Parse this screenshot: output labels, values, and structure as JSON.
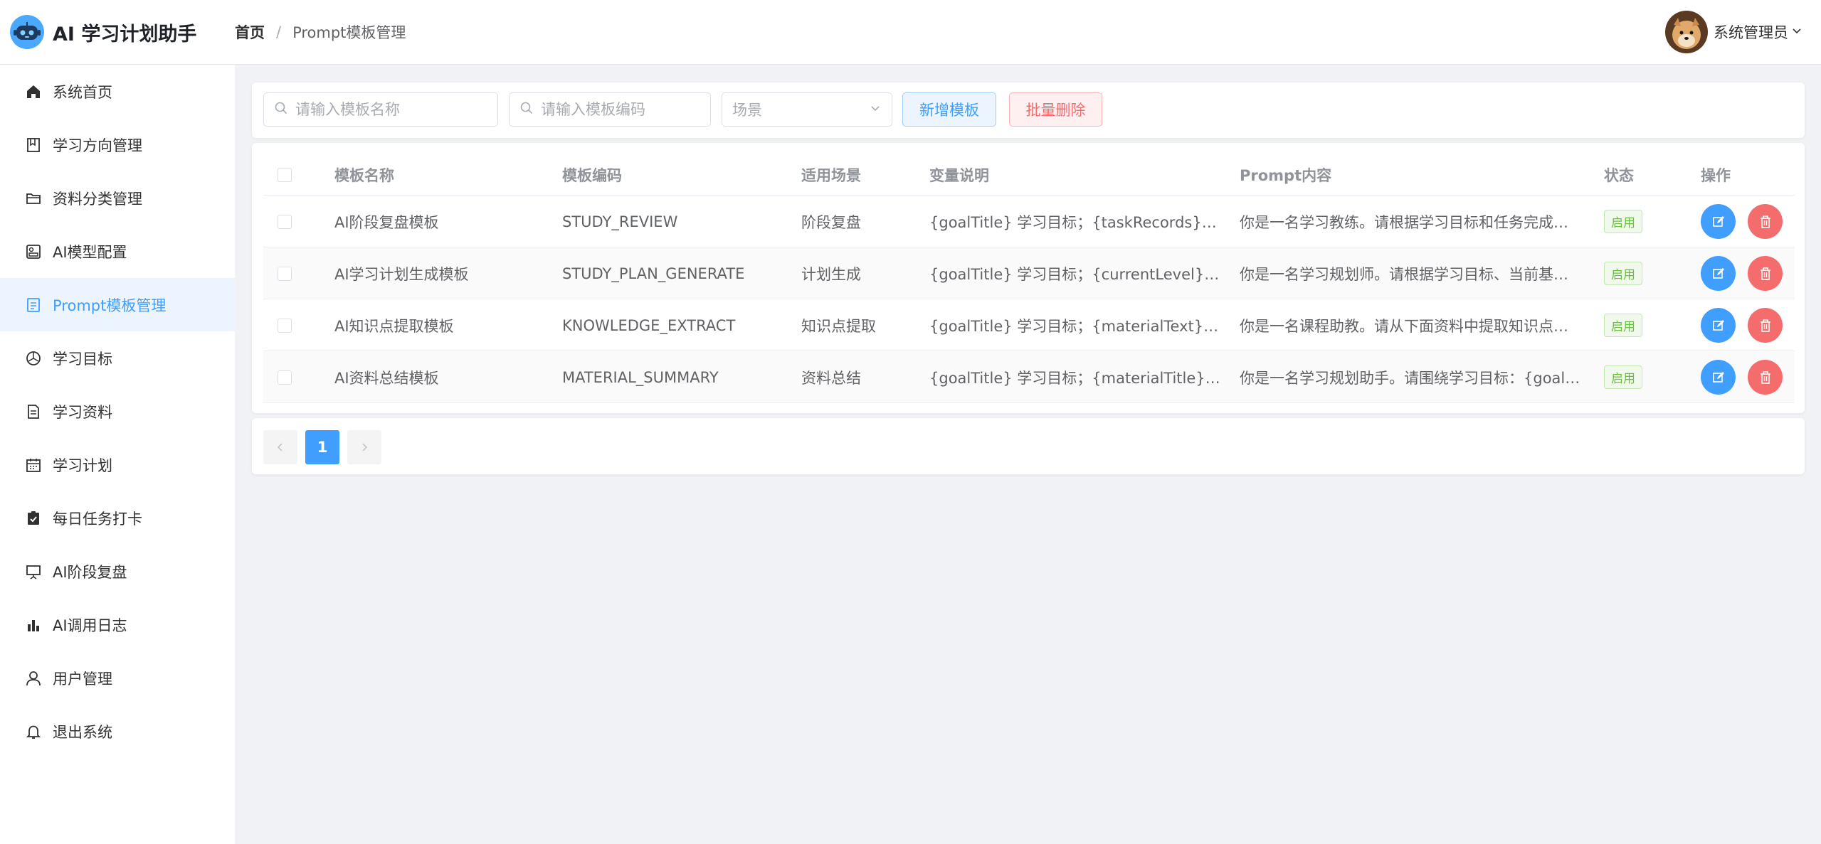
{
  "app": {
    "title": "AI 学习计划助手",
    "logo_icon": "robot-icon"
  },
  "breadcrumb": {
    "home": "首页",
    "separator": "/",
    "current": "Prompt模板管理"
  },
  "user": {
    "name": "系统管理员"
  },
  "sidebar": {
    "items": [
      {
        "label": "系统首页",
        "icon": "home-icon",
        "active": false
      },
      {
        "label": "学习方向管理",
        "icon": "bookmark-icon",
        "active": false
      },
      {
        "label": "资料分类管理",
        "icon": "folder-icon",
        "active": false
      },
      {
        "label": "AI模型配置",
        "icon": "model-config-icon",
        "active": false
      },
      {
        "label": "Prompt模板管理",
        "icon": "document-icon",
        "active": true
      },
      {
        "label": "学习目标",
        "icon": "target-icon",
        "active": false
      },
      {
        "label": "学习资料",
        "icon": "file-icon",
        "active": false
      },
      {
        "label": "学习计划",
        "icon": "calendar-icon",
        "active": false
      },
      {
        "label": "每日任务打卡",
        "icon": "checklist-icon",
        "active": false
      },
      {
        "label": "AI阶段复盘",
        "icon": "presentation-icon",
        "active": false
      },
      {
        "label": "AI调用日志",
        "icon": "bar-chart-icon",
        "active": false
      },
      {
        "label": "用户管理",
        "icon": "user-icon",
        "active": false
      },
      {
        "label": "退出系统",
        "icon": "bell-icon",
        "active": false
      }
    ]
  },
  "filters": {
    "name_placeholder": "请输入模板名称",
    "code_placeholder": "请输入模板编码",
    "scene_placeholder": "场景",
    "add_label": "新增模板",
    "batch_delete_label": "批量删除"
  },
  "table": {
    "headers": {
      "name": "模板名称",
      "code": "模板编码",
      "scene": "适用场景",
      "vars": "变量说明",
      "content": "Prompt内容",
      "status": "状态",
      "actions": "操作"
    },
    "rows": [
      {
        "name": "AI阶段复盘模板",
        "code": "STUDY_REVIEW",
        "scene": "阶段复盘",
        "vars": "{goalTitle} 学习目标；{taskRecords} 任…",
        "content": "你是一名学习教练。请根据学习目标和任务完成…",
        "status": "启用"
      },
      {
        "name": "AI学习计划生成模板",
        "code": "STUDY_PLAN_GENERATE",
        "scene": "计划生成",
        "vars": "{goalTitle} 学习目标；{currentLevel} 当…",
        "content": "你是一名学习规划师。请根据学习目标、当前基…",
        "status": "启用"
      },
      {
        "name": "AI知识点提取模板",
        "code": "KNOWLEDGE_EXTRACT",
        "scene": "知识点提取",
        "vars": "{goalTitle} 学习目标；{materialText} 资…",
        "content": "你是一名课程助教。请从下面资料中提取知识点…",
        "status": "启用"
      },
      {
        "name": "AI资料总结模板",
        "code": "MATERIAL_SUMMARY",
        "scene": "资料总结",
        "vars": "{goalTitle} 学习目标；{materialTitle} 资…",
        "content": "你是一名学习规划助手。请围绕学习目标：{goal…",
        "status": "启用"
      }
    ]
  },
  "pagination": {
    "current_page": "1",
    "prev_icon": "chevron-left-icon",
    "next_icon": "chevron-right-icon"
  },
  "colors": {
    "primary": "#409eff",
    "danger": "#f56c6c",
    "success": "#67c23a",
    "active_bg": "#ecf5ff"
  }
}
